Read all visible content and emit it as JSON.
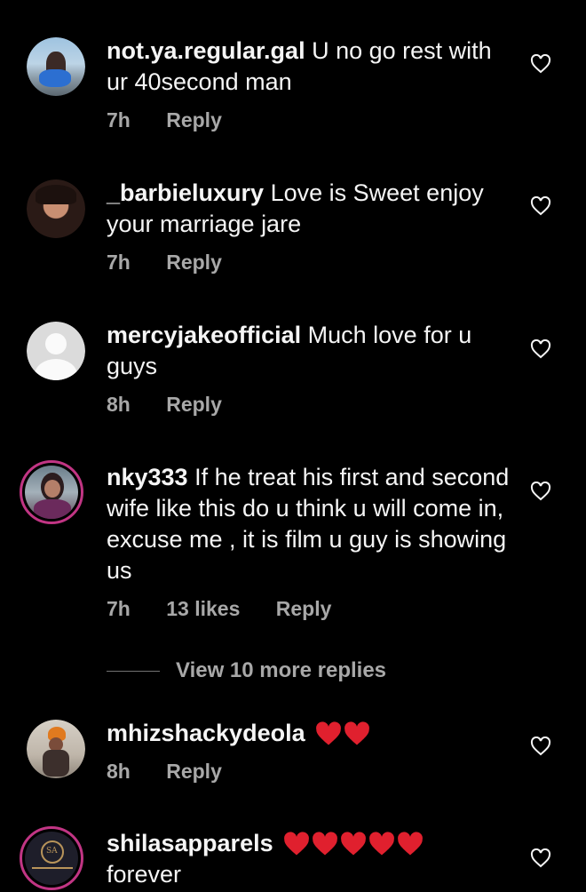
{
  "comments": [
    {
      "username": "not.ya.regular.gal",
      "text": "U no go rest with ur 40second man",
      "time": "7h",
      "likes": "",
      "reply": "Reply"
    },
    {
      "username": "_barbieluxury",
      "text": "Love is Sweet enjoy your marriage jare",
      "time": "7h",
      "likes": "",
      "reply": "Reply"
    },
    {
      "username": "mercyjakeofficial",
      "text": "Much love for u guys",
      "time": "8h",
      "likes": "",
      "reply": "Reply"
    },
    {
      "username": "nky333",
      "text": "If he treat his first and second wife like this do u think u will come in, excuse me , it is film u guy is showing us",
      "time": "7h",
      "likes": "13 likes",
      "reply": "Reply"
    },
    {
      "username": "mhizshackydeola",
      "text": "",
      "emoji_hearts": 2,
      "time": "8h",
      "likes": "",
      "reply": "Reply"
    },
    {
      "username": "shilasapparels",
      "text": "forever",
      "emoji_hearts": 5,
      "time": "",
      "likes": "",
      "reply": ""
    }
  ],
  "view_more_replies": "View 10 more replies",
  "colors": {
    "background": "#000000",
    "text": "#f5f5f5",
    "meta": "#a8a8a8",
    "heart_emoji": "#e0202e",
    "story_ring": "#c13584"
  },
  "icons": {
    "like": "heart-outline-icon",
    "emoji": "red-heart-emoji"
  }
}
